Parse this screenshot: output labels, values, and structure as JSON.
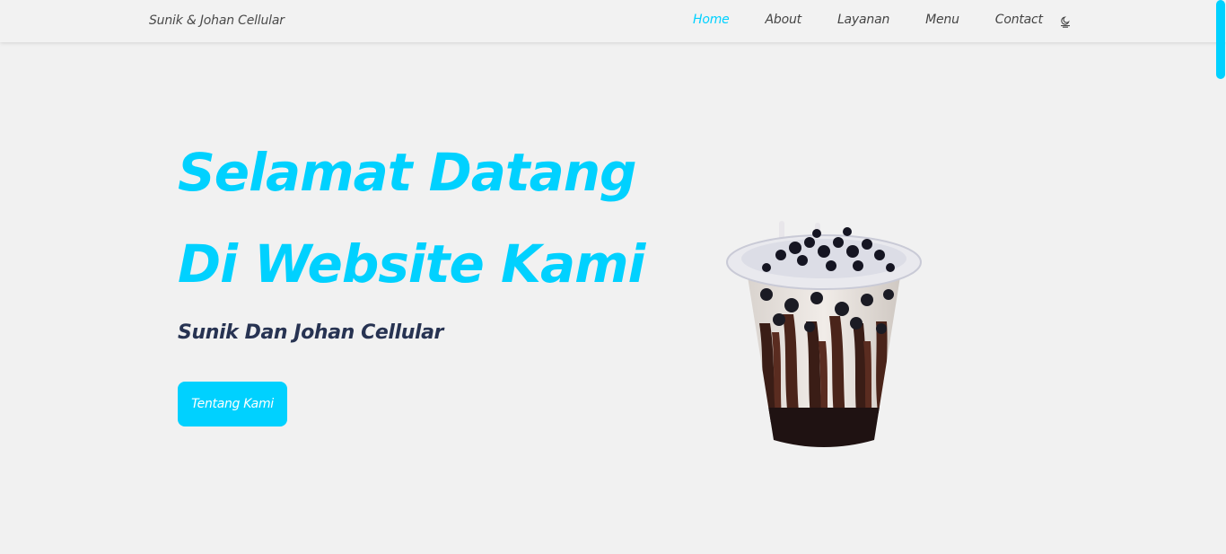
{
  "navbar": {
    "brand": "Sunik & Johan Cellular",
    "links": [
      "Home",
      "About",
      "Layanan",
      "Menu",
      "Contact"
    ],
    "active_link": "Home",
    "theme_toggle_icon": "moon-icon"
  },
  "hero": {
    "title_line1": "Selamat Datang",
    "title_line2": "Di Website Kami",
    "subtitle": "Sunik Dan Johan Cellular",
    "button_label": "Tentang Kami",
    "image_icon": "boba-drink-image"
  },
  "colors": {
    "accent": "#00d1ff",
    "subtitle": "#273352",
    "background": "#f1f1f1",
    "nav_text": "#444444"
  }
}
